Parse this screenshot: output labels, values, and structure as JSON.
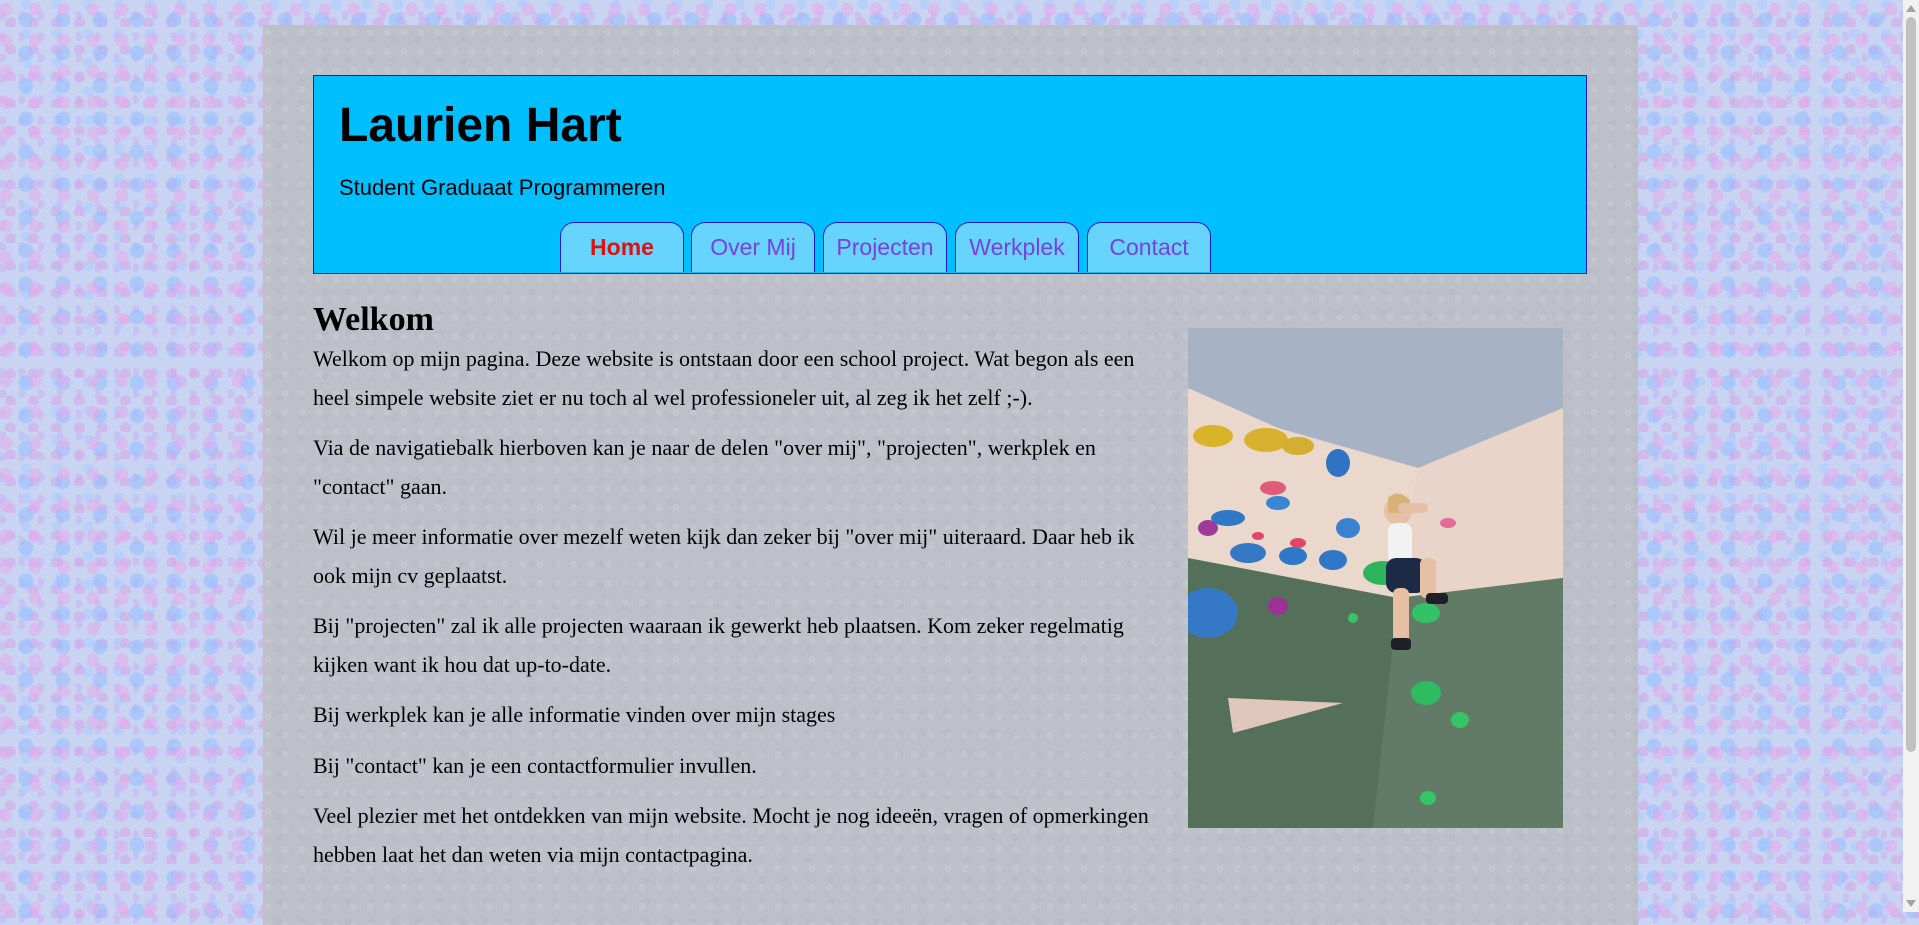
{
  "header": {
    "title": "Laurien Hart",
    "subtitle": "Student Graduaat Programmeren"
  },
  "nav": {
    "active": "Home",
    "tabs": [
      {
        "label": "Home"
      },
      {
        "label": "Over Mij"
      },
      {
        "label": "Projecten"
      },
      {
        "label": "Werkplek"
      },
      {
        "label": "Contact"
      }
    ]
  },
  "main": {
    "heading": "Welkom",
    "paragraphs": [
      "Welkom op mijn pagina. Deze website is ontstaan door een school project. Wat begon als een heel simpele website ziet er nu toch al wel professioneler uit, al zeg ik het zelf ;-).",
      "Via de navigatiebalk hierboven kan je naar de delen \"over mij\", \"projecten\", werkplek en \"contact\" gaan.",
      "Wil je meer informatie over mezelf weten kijk dan zeker bij \"over mij\" uiteraard. Daar heb ik ook mijn cv geplaatst.",
      "Bij \"projecten\" zal ik alle projecten waaraan ik gewerkt heb plaatsen. Kom zeker regelmatig kijken want ik hou dat up-to-date.",
      "Bij werkplek kan je alle informatie vinden over mijn stages",
      "Bij \"contact\" kan je een contactformulier invullen.",
      "Veel plezier met het ontdekken van mijn website. Mocht je nog ideeën, vragen of opmerkingen hebben laat het dan weten via mijn contactpagina."
    ]
  },
  "colors": {
    "header_bg": "#00bfff",
    "tab_bg": "#66d4ff",
    "tab_text": "#7b3fe0",
    "active_tab_text": "#e01010",
    "container_bg": "#bdc0c9"
  },
  "icons": [
    "scroll-up-arrow-icon",
    "scroll-down-arrow-icon"
  ]
}
